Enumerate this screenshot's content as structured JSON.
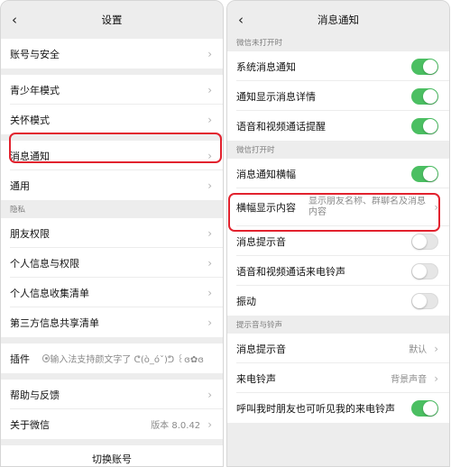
{
  "left": {
    "title": "设置",
    "back_icon": "chevron-left-icon",
    "account_security": "账号与安全",
    "youth_mode": "青少年模式",
    "care_mode": "关怀模式",
    "notifications": "消息通知",
    "general": "通用",
    "privacy_section": "隐私",
    "friend_permissions": "朋友权限",
    "personal_info_permissions": "个人信息与权限",
    "personal_info_collection": "个人信息收集清单",
    "third_party_sharing": "第三方信息共享清单",
    "plugins": "插件",
    "plugins_value": "输入法支持颜文字了 ᕦ(ò_óˇ)ᕤ ꒰ɞ✿ɞ꒱ ෆ",
    "help_feedback": "帮助与反馈",
    "about_wechat": "关于微信",
    "version": "版本 8.0.42",
    "switch_account": "切换账号"
  },
  "right": {
    "title": "消息通知",
    "back_icon": "chevron-left-icon",
    "section_not_open": "微信未打开时",
    "system_notification": "系统消息通知",
    "show_details": "通知显示消息详情",
    "call_reminder": "语音和视频通话提醒",
    "section_open": "微信打开时",
    "banner": "消息通知横幅",
    "banner_content": "横幅显示内容",
    "banner_content_value": "显示朋友名称、群聊名及消息内容",
    "message_sound": "消息提示音",
    "call_ringtone": "语音和视频通话来电铃声",
    "vibrate": "振动",
    "section_sounds": "提示音与铃声",
    "message_tone": "消息提示音",
    "message_tone_value": "默认",
    "ringtone": "来电铃声",
    "ringtone_value": "背景声音",
    "friend_hear_ringtone": "呼叫我时朋友也可听见我的来电铃声"
  },
  "toggles": {
    "system_notification": true,
    "show_details": true,
    "call_reminder": true,
    "banner": true,
    "message_sound": false,
    "call_ringtone": false,
    "vibrate": false,
    "friend_hear_ringtone": true
  },
  "colors": {
    "toggle_on": "#4bbf62",
    "highlight": "#e2222e",
    "background": "#ededed"
  }
}
